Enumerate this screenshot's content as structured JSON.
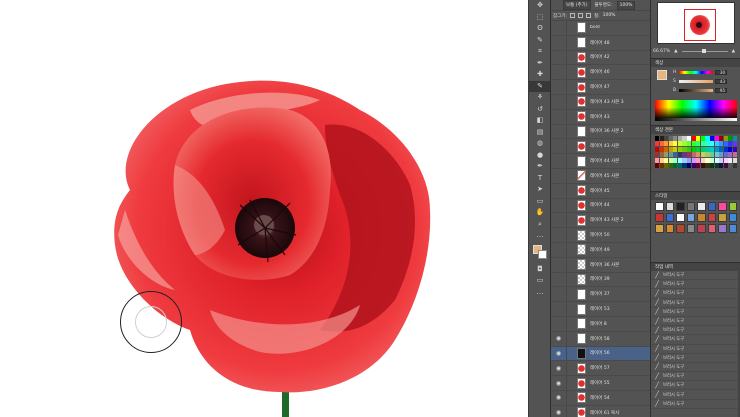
{
  "layers_panel": {
    "blend_mode": "보통 (추가)",
    "opacity_label": "불투명도:",
    "opacity": "100%",
    "lock_label": "잠그기:",
    "fill_label": "칠:",
    "fill": "100%",
    "layers": [
      {
        "name": "bold",
        "thumb": "white",
        "visible": false
      },
      {
        "name": "레이어 48",
        "thumb": "white",
        "visible": false
      },
      {
        "name": "레이어 42",
        "thumb": "red",
        "visible": false
      },
      {
        "name": "레이어 46",
        "thumb": "red",
        "visible": false
      },
      {
        "name": "레이어 47",
        "thumb": "red",
        "visible": false
      },
      {
        "name": "레이어 43 사본 3",
        "thumb": "red",
        "visible": false
      },
      {
        "name": "레이어 43",
        "thumb": "red",
        "visible": false
      },
      {
        "name": "레이어 36 사본 2",
        "thumb": "white",
        "visible": false
      },
      {
        "name": "레이어 43 사본",
        "thumb": "red",
        "visible": false
      },
      {
        "name": "레이어 44 사본",
        "thumb": "white",
        "visible": false
      },
      {
        "name": "레이어 45 사본",
        "thumb": "stroke",
        "visible": false
      },
      {
        "name": "레이어 45",
        "thumb": "red",
        "visible": false
      },
      {
        "name": "레이어 44",
        "thumb": "red",
        "visible": false
      },
      {
        "name": "레이어 43 사본 2",
        "thumb": "red",
        "visible": false
      },
      {
        "name": "레이어 50",
        "thumb": "checker",
        "visible": false
      },
      {
        "name": "레이어 49",
        "thumb": "checker",
        "visible": false
      },
      {
        "name": "레이어 36 사본",
        "thumb": "checker",
        "visible": false
      },
      {
        "name": "레이어 39",
        "thumb": "checker",
        "visible": false
      },
      {
        "name": "레이어 37",
        "thumb": "white",
        "visible": false
      },
      {
        "name": "레이어 53",
        "thumb": "white",
        "visible": false
      },
      {
        "name": "레이어 8",
        "thumb": "white",
        "visible": false
      },
      {
        "name": "레이어 58",
        "thumb": "white",
        "visible": true
      },
      {
        "name": "레이어 56",
        "thumb": "dark",
        "visible": true,
        "selected": true
      },
      {
        "name": "레이어 57",
        "thumb": "red",
        "visible": true
      },
      {
        "name": "레이어 55",
        "thumb": "red",
        "visible": true
      },
      {
        "name": "레이어 54",
        "thumb": "red",
        "visible": true
      },
      {
        "name": "레이어 61 복사",
        "thumb": "red",
        "visible": true
      }
    ]
  },
  "navigator": {
    "zoom": "66.67%"
  },
  "color_panel": {
    "title": "색상",
    "sliders": [
      {
        "label": "H",
        "value": "30"
      },
      {
        "label": "S",
        "value": "43"
      },
      {
        "label": "B",
        "value": "95"
      }
    ],
    "foreground": "#e8b47c"
  },
  "swatches_panel": {
    "title": "색상 견본"
  },
  "styles_panel": {
    "title": "스타일"
  },
  "history_panel": {
    "title": "작업 내역",
    "items": [
      "브러시 도구",
      "브러시 도구",
      "브러시 도구",
      "브러시 도구",
      "브러시 도구",
      "브러시 도구",
      "브러시 도구",
      "브러시 도구",
      "브러시 도구",
      "브러시 도구",
      "브러시 도구",
      "브러시 도구",
      "브러시 도구",
      "브러시 도구",
      "브러시 도구"
    ]
  },
  "tools": [
    "move-icon",
    "marquee-icon",
    "lasso-icon",
    "quick-select-icon",
    "crop-icon",
    "eyedropper-icon",
    "healing-icon",
    "brush-icon",
    "stamp-icon",
    "history-brush-icon",
    "eraser-icon",
    "gradient-icon",
    "blur-icon",
    "dodge-icon",
    "pen-icon",
    "type-icon",
    "path-select-icon",
    "shape-icon",
    "hand-icon",
    "zoom-icon",
    "extra-icon"
  ],
  "tool_glyphs": [
    "✥",
    "⬚",
    "ʘ",
    "✎",
    "⌗",
    "✒",
    "✚",
    "✎",
    "⚘",
    "↺",
    "◧",
    "▤",
    "◍",
    "●",
    "✒",
    "T",
    "➤",
    "▭",
    "✋",
    "⌕",
    "…"
  ]
}
